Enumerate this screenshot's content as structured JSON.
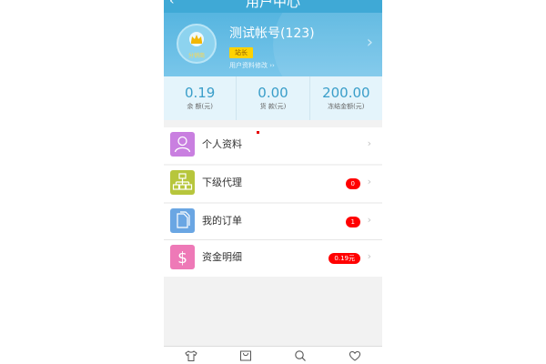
{
  "header": {
    "back_glyph": "‹",
    "title": "用户中心"
  },
  "profile": {
    "avatar_tag": "分销商",
    "account_name": "测试帐号(123)",
    "role_badge": "站长",
    "edit_link": "用户资料修改 ››",
    "chevron": "›"
  },
  "stats": [
    {
      "value": "0.19",
      "label": "余 额(元)"
    },
    {
      "value": "0.00",
      "label": "货 款(元)"
    },
    {
      "value": "200.00",
      "label": "冻结金额(元)"
    }
  ],
  "menu": [
    {
      "label": "个人资料",
      "icon": "person-icon",
      "color": "#c97fe0",
      "badge": ""
    },
    {
      "label": "下级代理",
      "icon": "org-chart-icon",
      "color": "#b7c63c",
      "badge": "0"
    },
    {
      "label": "我的订单",
      "icon": "document-icon",
      "color": "#6aa6e3",
      "badge": "1"
    },
    {
      "label": "资金明细",
      "icon": "dollar-icon",
      "color": "#ee79b7",
      "badge": "0.19元"
    }
  ],
  "row_chevron": "›",
  "tabbar": [
    {
      "icon": "shirt-icon"
    },
    {
      "icon": "bag-icon"
    },
    {
      "icon": "search-icon"
    },
    {
      "icon": "heart-icon"
    }
  ]
}
